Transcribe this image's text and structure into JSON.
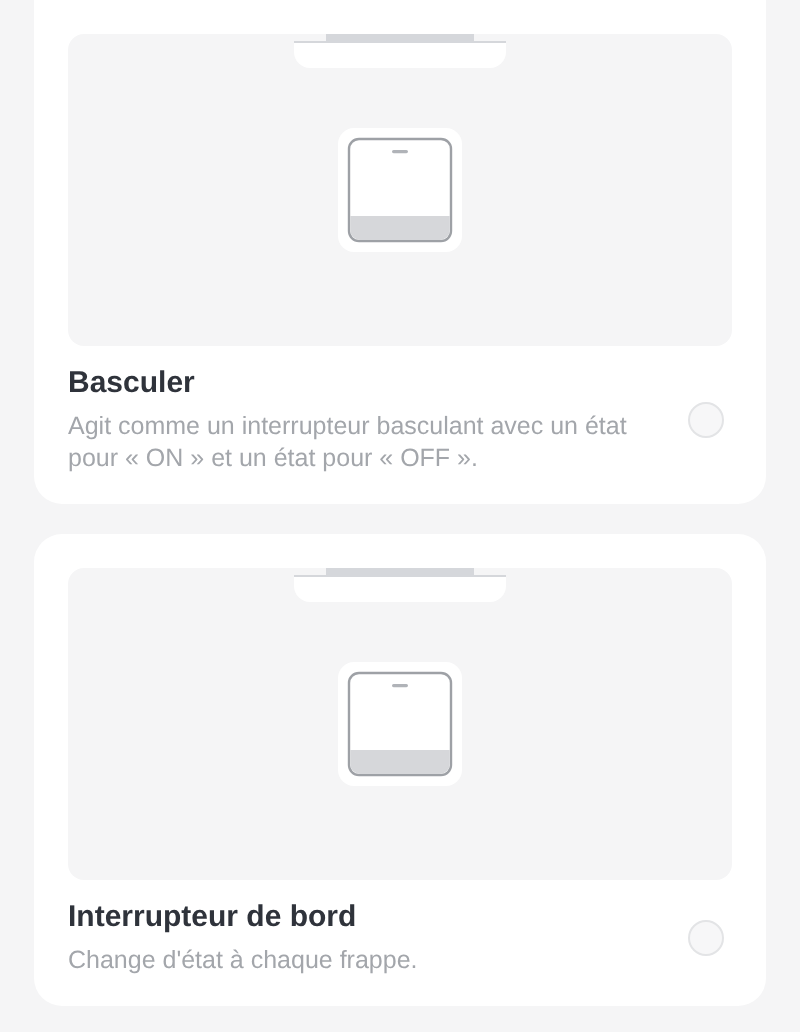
{
  "options": [
    {
      "kind": "switch",
      "title": "Basculer",
      "description": "Agit comme un interrupteur basculant avec un état pour « ON » et un état pour « OFF ».",
      "selected": false
    },
    {
      "kind": "switch",
      "title": "Interrupteur de bord",
      "description": "Change d'état à chaque frappe.",
      "selected": false
    }
  ]
}
